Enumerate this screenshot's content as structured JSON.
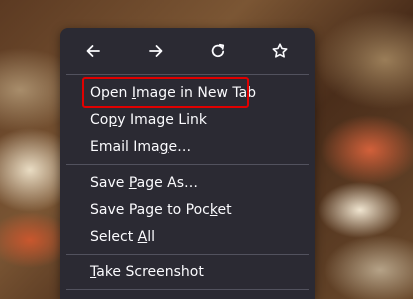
{
  "context_menu": {
    "nav_buttons": [
      {
        "name": "back",
        "icon": "arrow-left-icon"
      },
      {
        "name": "forward",
        "icon": "arrow-right-icon"
      },
      {
        "name": "reload",
        "icon": "reload-icon"
      },
      {
        "name": "bookmark",
        "icon": "star-icon"
      }
    ],
    "items": [
      {
        "pre": "Open ",
        "key": "I",
        "post": "mage in New Tab"
      },
      {
        "pre": "Co",
        "key": "p",
        "post": "y Image Link"
      },
      {
        "pre": "Email Ima",
        "key": "g",
        "post": "e…"
      },
      {
        "pre": "Save ",
        "key": "P",
        "post": "age As…"
      },
      {
        "pre": "Save Page to Poc",
        "key": "k",
        "post": "et"
      },
      {
        "pre": "Select ",
        "key": "A",
        "post": "ll"
      },
      {
        "pre": "",
        "key": "T",
        "post": "ake Screenshot"
      }
    ]
  },
  "colors": {
    "menu_bg": "#2b2a33",
    "menu_text": "#fbfbfe",
    "separator": "#52525e",
    "highlight_border": "#e00000"
  }
}
